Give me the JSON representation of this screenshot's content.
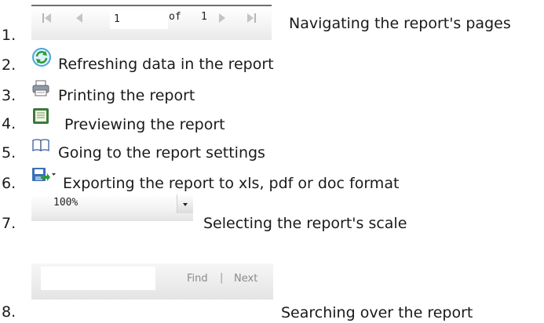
{
  "items": [
    {
      "number": "1.",
      "description": "Navigating the report's pages"
    },
    {
      "number": "2.",
      "description": "Refreshing data in the report"
    },
    {
      "number": "3.",
      "description": "Printing the report"
    },
    {
      "number": "4.",
      "description": "Previewing the report"
    },
    {
      "number": "5.",
      "description": "Going to the report settings"
    },
    {
      "number": "6.",
      "description": "Exporting the report to xls, pdf or doc format"
    },
    {
      "number": "7.",
      "description": "Selecting the report's scale"
    },
    {
      "number": "8.",
      "description": "Searching over the report"
    }
  ],
  "pager": {
    "page_value": "1",
    "of_label": "of",
    "total_pages": "1"
  },
  "zoom": {
    "value": "100%"
  },
  "search": {
    "placeholder": "",
    "find_label": "Find",
    "separator": "|",
    "next_label": "Next"
  },
  "icons": {
    "first_page": "first-page-icon",
    "prev_page": "prev-page-icon",
    "next_page": "next-page-icon",
    "last_page": "last-page-icon",
    "refresh": "refresh-icon",
    "print": "printer-icon",
    "preview": "preview-document-icon",
    "settings": "open-book-icon",
    "export": "save-export-icon",
    "dropdown": "dropdown-arrow-icon"
  }
}
